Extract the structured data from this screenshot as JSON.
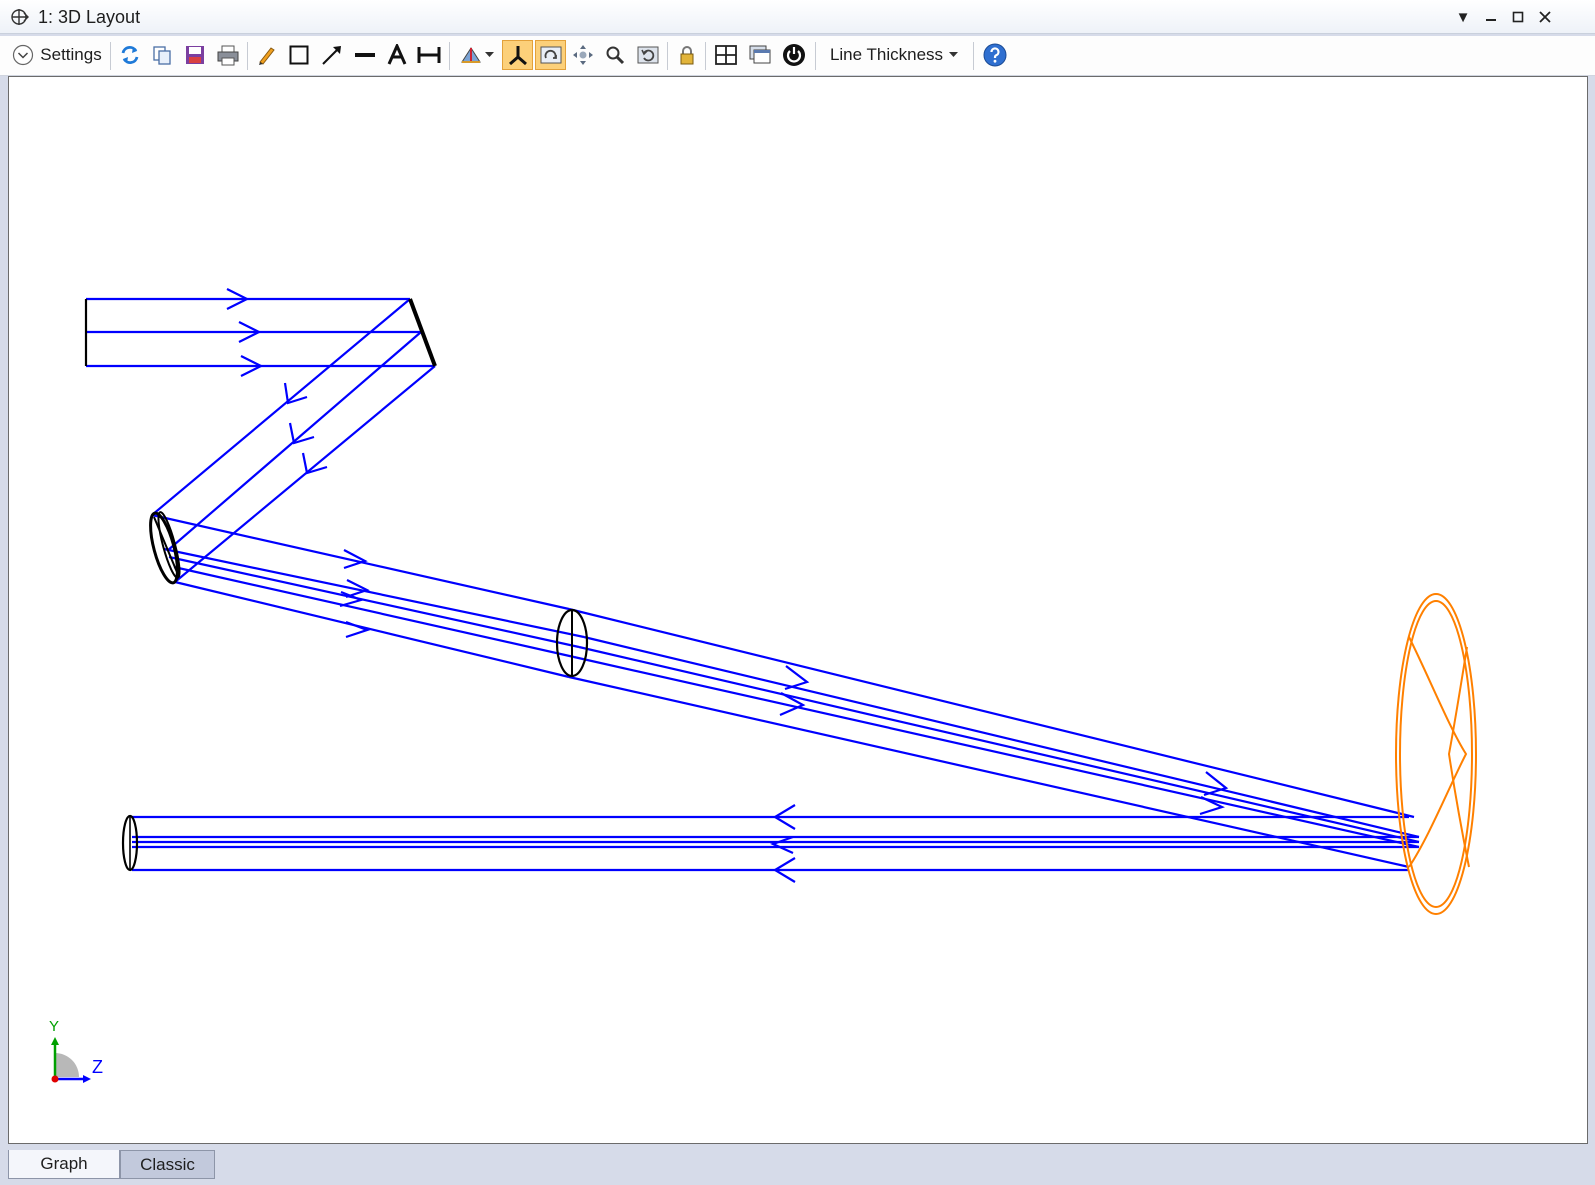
{
  "window": {
    "title": "1: 3D Layout"
  },
  "toolbar": {
    "settings_label": "Settings",
    "line_thickness_label": "Line Thickness"
  },
  "tabs": [
    {
      "label": "Graph",
      "active": true
    },
    {
      "label": "Classic",
      "active": false
    }
  ],
  "axis_triad": {
    "y_label": "Y",
    "z_label": "Z"
  },
  "colors": {
    "ray": "#0000ff",
    "surface": "#000000",
    "image_surface": "#ff8000",
    "active_button": "#fcd07a"
  }
}
